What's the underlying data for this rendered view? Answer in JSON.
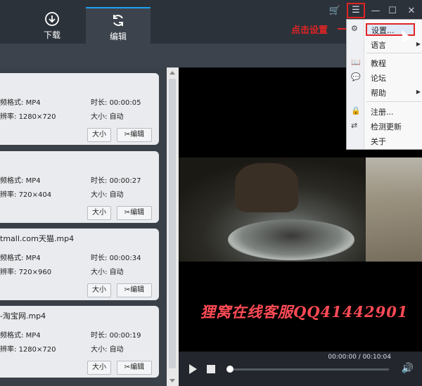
{
  "tabs": [
    {
      "label": "下载",
      "icon": "download-icon"
    },
    {
      "label": "编辑",
      "icon": "refresh-icon"
    }
  ],
  "window": {
    "cart": "🛒",
    "menu": "☰",
    "minimize": "—",
    "maximize": "☐",
    "close": "✕"
  },
  "files": [
    {
      "name": "",
      "format": "MP4",
      "duration": "00:00:05",
      "resolution": "1280×720",
      "size": "自动"
    },
    {
      "name": "",
      "format": "MP4",
      "duration": "00:00:27",
      "resolution": "720×404",
      "size": "自动"
    },
    {
      "name": "tmall.com天猫.mp4",
      "format": "MP4",
      "duration": "00:00:34",
      "resolution": "720×960",
      "size": "自动"
    },
    {
      "name": "-淘宝网.mp4",
      "format": "MP4",
      "duration": "00:00:19",
      "resolution": "1280×720",
      "size": "自动"
    }
  ],
  "labels": {
    "format": "频格式: ",
    "duration": "时长: ",
    "resolution": "辨率: ",
    "size": "大小: ",
    "size_btn": "大小",
    "edit_btn": "编辑"
  },
  "menu": {
    "items": [
      {
        "label": "设置...",
        "highlight": true
      },
      {
        "label": "语言",
        "submenu": true
      },
      {
        "label": "教程"
      },
      {
        "label": "论坛"
      },
      {
        "label": "帮助",
        "submenu": true
      },
      {
        "label": "注册..."
      },
      {
        "label": "检测更新"
      },
      {
        "label": "关于"
      }
    ]
  },
  "annotation": "点击设置",
  "watermark": "狸窝在线客服QQ41442901",
  "player": {
    "time": "00:00:00 / 00:10:04",
    "progress": 0
  }
}
